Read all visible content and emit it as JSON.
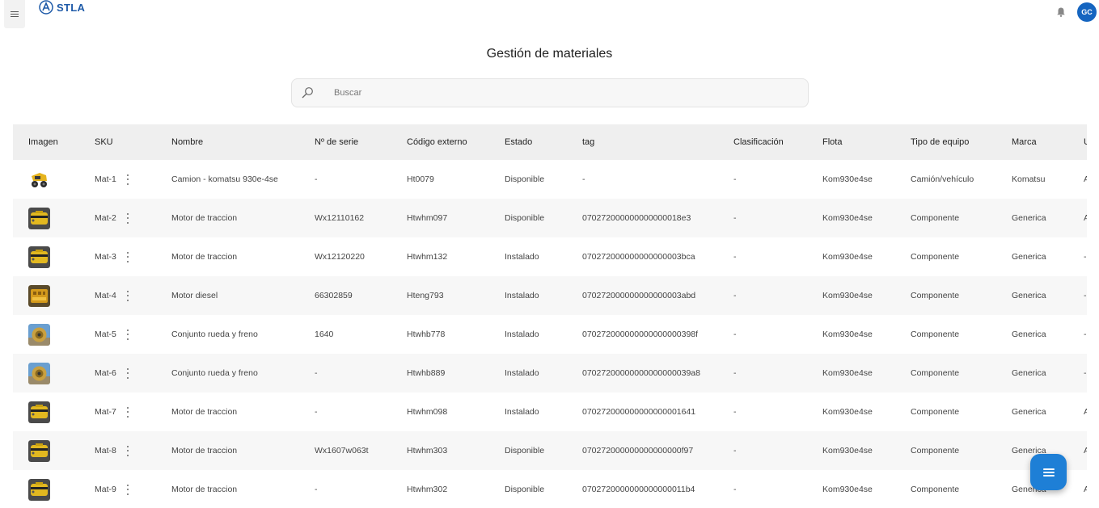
{
  "header": {
    "app_name": "STLA",
    "avatar_initials": "GC",
    "menu_icon": "hamburger-icon",
    "bell_icon": "bell-icon"
  },
  "page": {
    "title": "Gestión de materiales"
  },
  "search": {
    "placeholder": "Buscar",
    "icon": "search-icon"
  },
  "table": {
    "columns": [
      "Imagen",
      "SKU",
      "Nombre",
      "Nº de serie",
      "Código externo",
      "Estado",
      "tag",
      "Clasificación",
      "Flota",
      "Tipo de equipo",
      "Marca",
      "U"
    ],
    "rows": [
      {
        "image": "truck",
        "sku": "Mat-1",
        "nombre": "Camion - komatsu 930e-4se",
        "serie": "-",
        "codigo": "Ht0079",
        "estado": "Disponible",
        "tag": "-",
        "clasificacion": "-",
        "flota": "Kom930e4se",
        "tipo": "Camión/vehículo",
        "marca": "Komatsu",
        "u": "A"
      },
      {
        "image": "motor",
        "sku": "Mat-2",
        "nombre": "Motor de traccion",
        "serie": "Wx12110162",
        "codigo": "Htwhm097",
        "estado": "Disponible",
        "tag": "070272000000000000018e3",
        "clasificacion": "-",
        "flota": "Kom930e4se",
        "tipo": "Componente",
        "marca": "Generica",
        "u": "A"
      },
      {
        "image": "motor",
        "sku": "Mat-3",
        "nombre": "Motor de traccion",
        "serie": "Wx12120220",
        "codigo": "Htwhm132",
        "estado": "Instalado",
        "tag": "070272000000000000003bca",
        "clasificacion": "-",
        "flota": "Kom930e4se",
        "tipo": "Componente",
        "marca": "Generica",
        "u": "-"
      },
      {
        "image": "diesel",
        "sku": "Mat-4",
        "nombre": "Motor diesel",
        "serie": "66302859",
        "codigo": "Hteng793",
        "estado": "Instalado",
        "tag": "070272000000000000003abd",
        "clasificacion": "-",
        "flota": "Kom930e4se",
        "tipo": "Componente",
        "marca": "Generica",
        "u": "-"
      },
      {
        "image": "wheel",
        "sku": "Mat-5",
        "nombre": "Conjunto rueda y freno",
        "serie": "1640",
        "codigo": "Htwhb778",
        "estado": "Instalado",
        "tag": "070272000000000000000398f",
        "clasificacion": "-",
        "flota": "Kom930e4se",
        "tipo": "Componente",
        "marca": "Generica",
        "u": "-"
      },
      {
        "image": "wheel",
        "sku": "Mat-6",
        "nombre": "Conjunto rueda y freno",
        "serie": "-",
        "codigo": "Htwhb889",
        "estado": "Instalado",
        "tag": "07027200000000000000039a8",
        "clasificacion": "-",
        "flota": "Kom930e4se",
        "tipo": "Componente",
        "marca": "Generica",
        "u": "-"
      },
      {
        "image": "motor",
        "sku": "Mat-7",
        "nombre": "Motor de traccion",
        "serie": "-",
        "codigo": "Htwhm098",
        "estado": "Instalado",
        "tag": "070272000000000000001641",
        "clasificacion": "-",
        "flota": "Kom930e4se",
        "tipo": "Componente",
        "marca": "Generica",
        "u": "A"
      },
      {
        "image": "motor",
        "sku": "Mat-8",
        "nombre": "Motor de traccion",
        "serie": "Wx1607w063t",
        "codigo": "Htwhm303",
        "estado": "Disponible",
        "tag": "070272000000000000000f97",
        "clasificacion": "-",
        "flota": "Kom930e4se",
        "tipo": "Componente",
        "marca": "Generica",
        "u": "A"
      },
      {
        "image": "motor",
        "sku": "Mat-9",
        "nombre": "Motor de traccion",
        "serie": "-",
        "codigo": "Htwhm302",
        "estado": "Disponible",
        "tag": "0702720000000000000011b4",
        "clasificacion": "-",
        "flota": "Kom930e4se",
        "tipo": "Componente",
        "marca": "Generica",
        "u": "A"
      }
    ]
  },
  "fab": {
    "icon": "list-menu-icon"
  },
  "colors": {
    "brand": "#1e5aa8",
    "avatar": "#1565c0",
    "fab": "#1e7fd6",
    "header_bg": "#efefef"
  }
}
